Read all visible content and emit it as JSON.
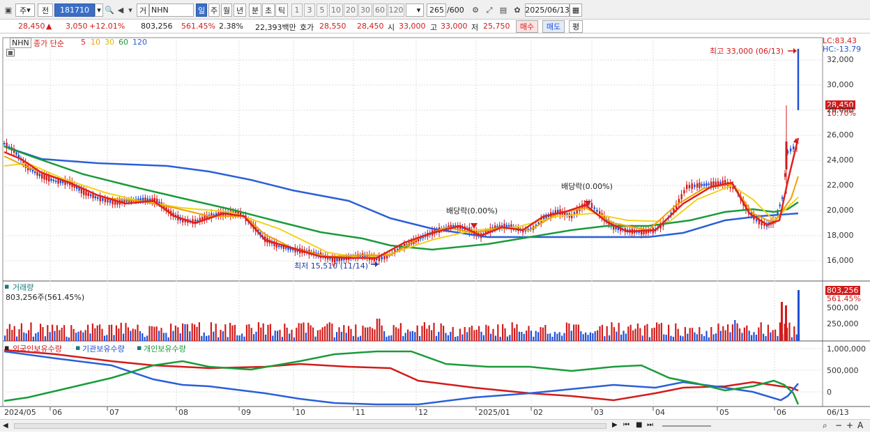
{
  "toolbar": {
    "period_label": "주",
    "prev_label": "전",
    "code": "181710",
    "market_label": "거",
    "stock_name": "NHN",
    "tabs": [
      "일",
      "주",
      "월",
      "년",
      "분",
      "초",
      "틱"
    ],
    "intervals": [
      "1",
      "3",
      "5",
      "10",
      "20",
      "30",
      "60",
      "120"
    ],
    "count": "265",
    "count_max": "/600",
    "date": "2025/06/13"
  },
  "info": {
    "price": "28,450",
    "change": "3,050",
    "change_pct": "+12.01%",
    "volume": "803,256",
    "volume_pct": "561.45%",
    "turnover": "2.38%",
    "amount": "22,393백만",
    "ask_label": "호가",
    "ask": "28,550",
    "bid": "28,450",
    "open_label": "시",
    "open": "33,000",
    "high_label": "고",
    "high": "33,000",
    "low_label": "저",
    "low": "25,750",
    "buy_label": "매수",
    "sell_label": "매도",
    "eval_label": "평"
  },
  "price_panel": {
    "legend_name": "NHN",
    "legend_title": "종가 단순",
    "ma_periods": [
      "5",
      "10",
      "30",
      "60",
      "120"
    ],
    "ma_colors": [
      "#e0201c",
      "#f0a000",
      "#f2d21b",
      "#1a9b3a",
      "#2b5fd8"
    ],
    "lc": "LC:83.43",
    "hc": "HC:-13.79",
    "current_price": "28,450",
    "current_pct": "10.70%",
    "high_note": "최고 33,000 (06/13)",
    "low_note": "최저 15,510 (11/14)",
    "dividend_note_1": "배당락(0.00%)",
    "dividend_note_2": "배당락(0.00%)",
    "y_ticks": [
      "32,000",
      "30,000",
      "28,000",
      "26,000",
      "24,000",
      "22,000",
      "20,000",
      "18,000",
      "16,000"
    ]
  },
  "volume_panel": {
    "title": "거래량",
    "subtitle": "803,256주(561.45%)",
    "current": "803,256",
    "current_pct": "561.45%",
    "y_ticks": [
      "500,000",
      "250,000"
    ]
  },
  "holding_panel": {
    "series_names": [
      "외국인보유수량",
      "기관보유수량",
      "개인보유수량"
    ],
    "y_ticks": [
      "1,000,000",
      "500,000",
      "0"
    ]
  },
  "x_axis": [
    "2024/05",
    "06",
    "07",
    "08",
    "09",
    "10",
    "11",
    "12",
    "2025/01",
    "02",
    "03",
    "04",
    "05",
    "06",
    "06/13"
  ],
  "colors": {
    "up": "#d21b1b",
    "down": "#1f4fd6",
    "foreign": "#d21b1b",
    "institution": "#2b5fd8",
    "individual": "#1a9b3a"
  }
}
